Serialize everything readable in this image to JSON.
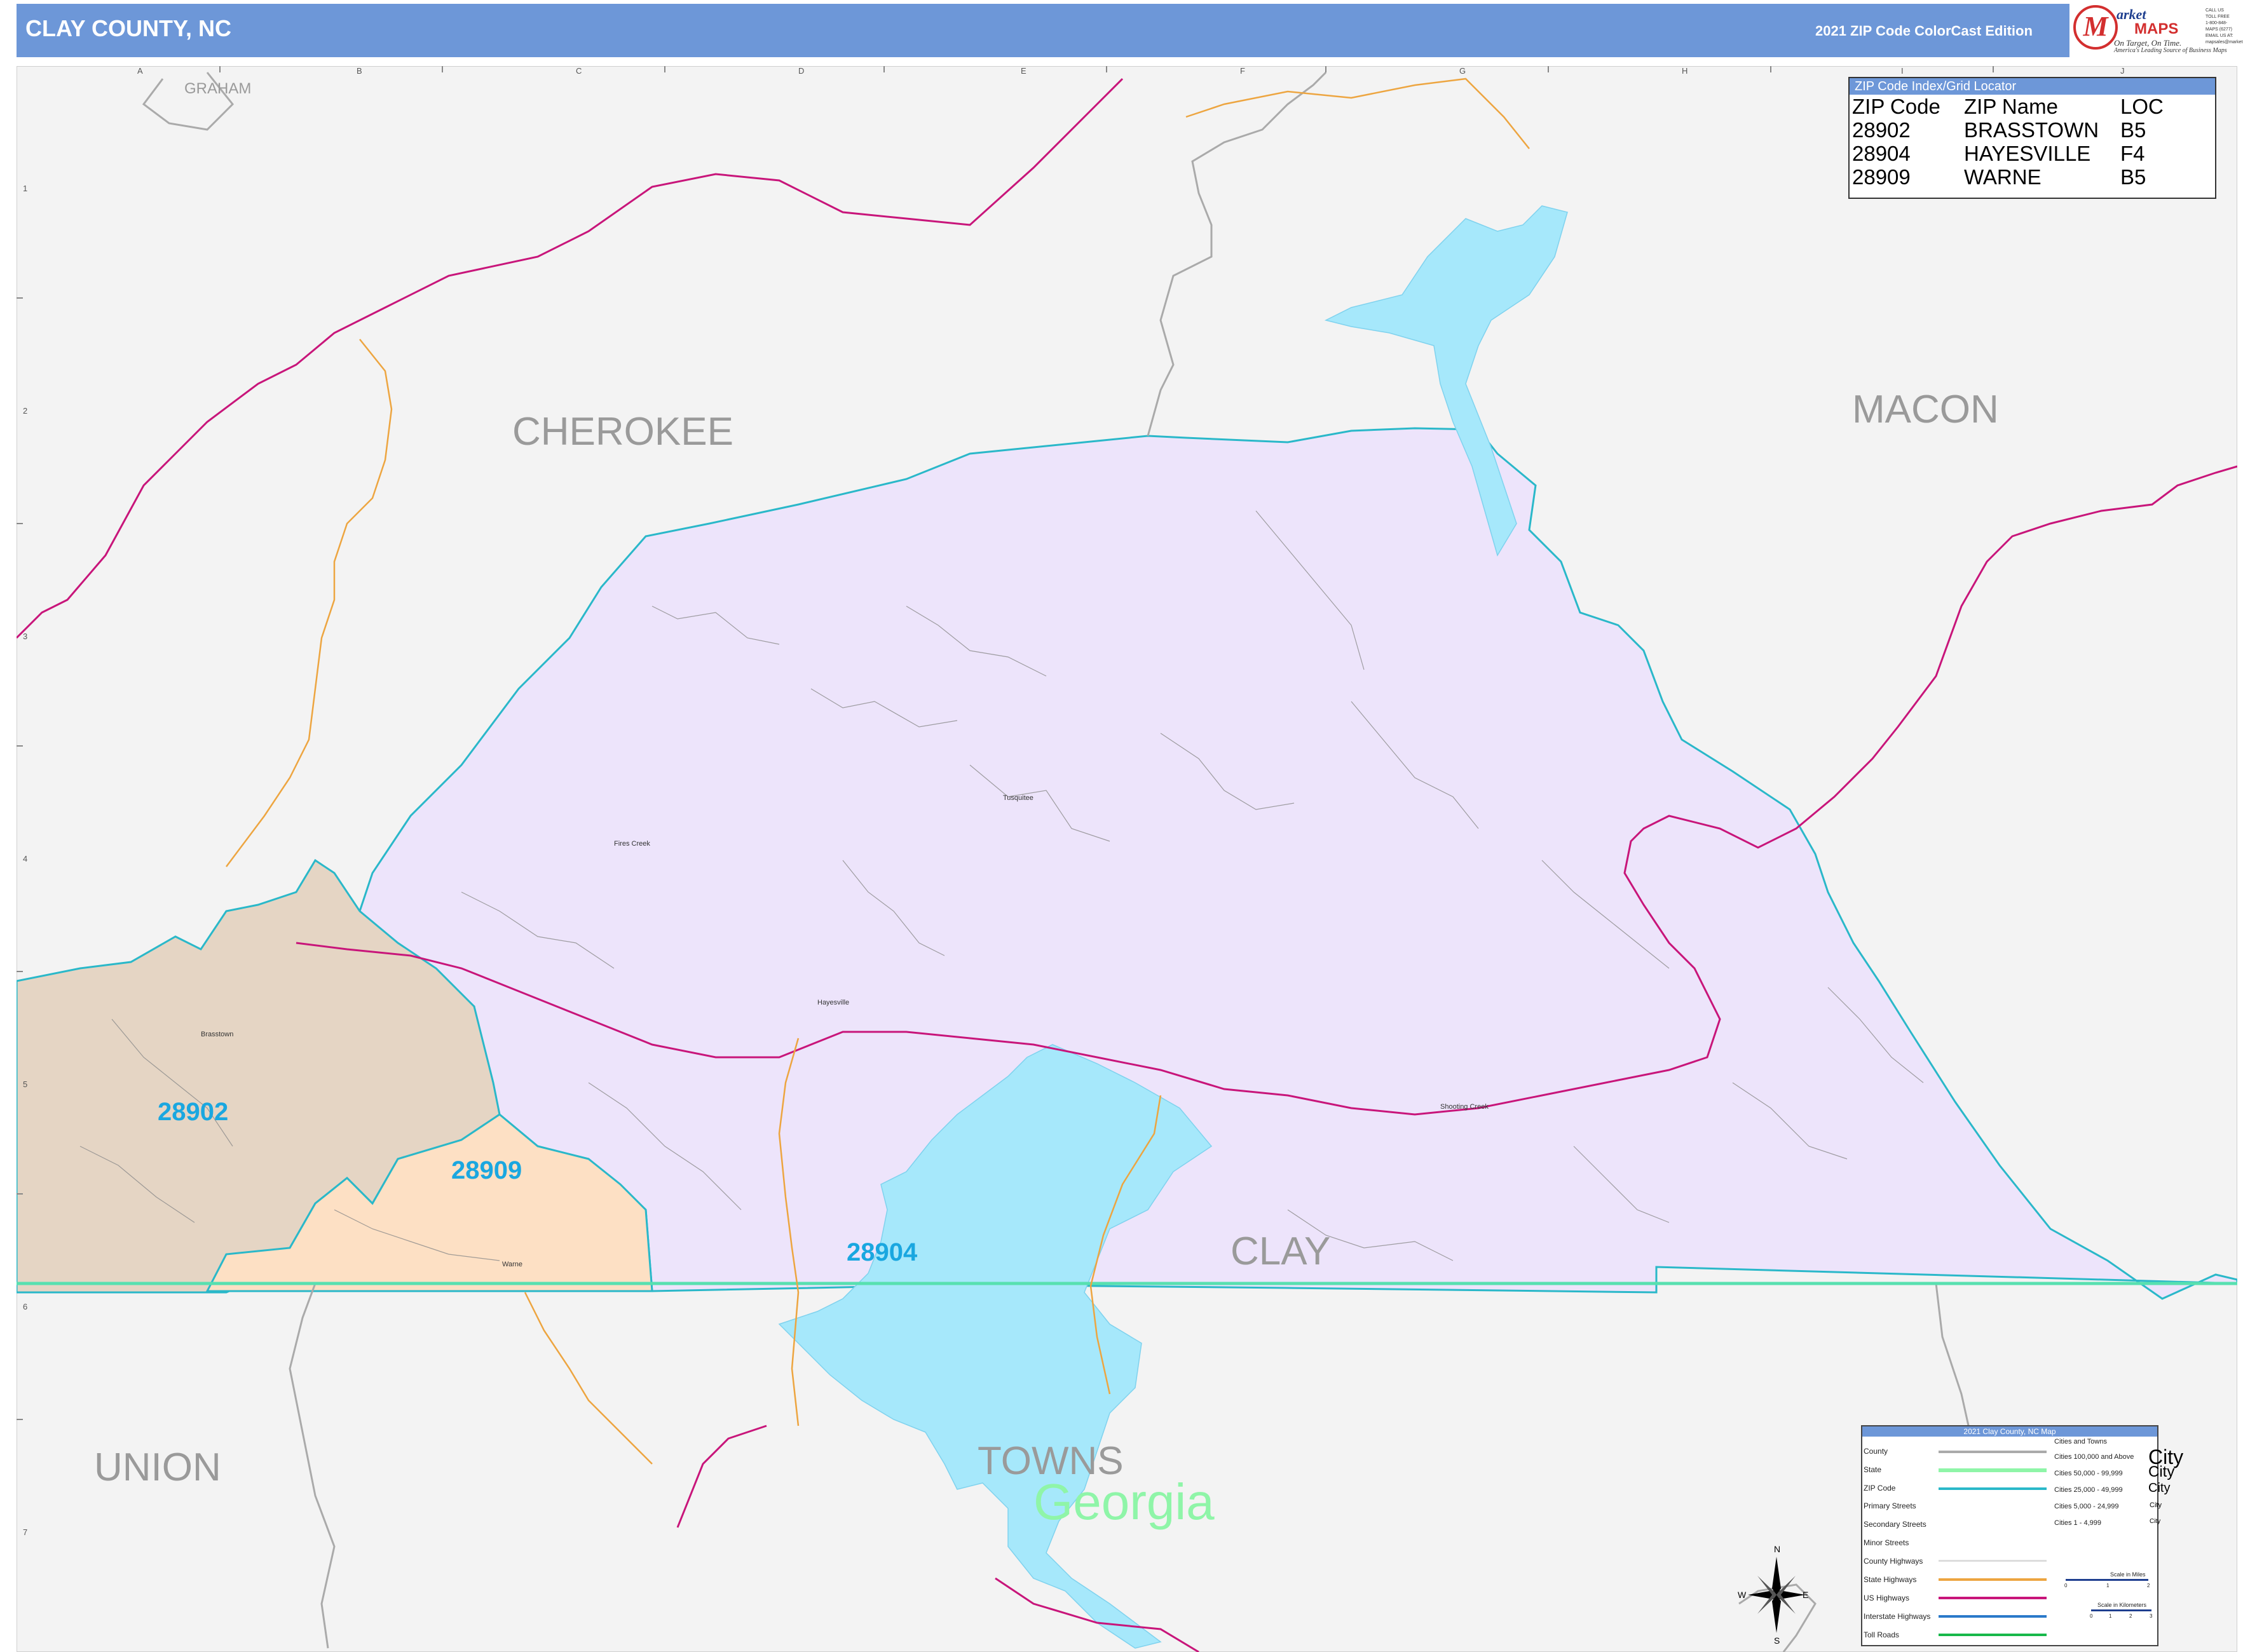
{
  "header": {
    "title": "CLAY COUNTY, NC",
    "edition": "2021 ZIP Code ColorCast Edition",
    "logo": {
      "letter": "M",
      "word1": "arket",
      "word2": "MAPS",
      "tagline": "On Target, On Time.",
      "tagline2": "America's Leading Source of Business Maps",
      "contact": [
        "CALL US TOLL FREE",
        "1-800-848-MAPS (6277)",
        "EMAIL US AT:",
        "mapsales@marketmaps.com"
      ]
    }
  },
  "grid": {
    "columns": [
      "A",
      "B",
      "C",
      "D",
      "E",
      "F",
      "G",
      "H",
      "I",
      "J"
    ],
    "rows": [
      "1",
      "2",
      "3",
      "4",
      "5",
      "6",
      "7"
    ]
  },
  "place_labels": {
    "graham": "GRAHAM",
    "cherokee": "CHEROKEE",
    "macon": "MACON",
    "clay": "CLAY",
    "union": "UNION",
    "towns": "TOWNS",
    "georgia": "Georgia"
  },
  "zip_labels": {
    "z28902": "28902",
    "z28909": "28909",
    "z28904": "28904"
  },
  "towns": {
    "brasstown": "Brasstown",
    "warne": "Warne",
    "hayesville": "Hayesville",
    "tusquitee": "Tusquitee",
    "fires_creek": "Fires Creek",
    "shooting_creek": "Shooting Creek"
  },
  "zip_index": {
    "title": "ZIP Code Index/Grid Locator",
    "headers": [
      "ZIP Code",
      "ZIP Name",
      "LOC"
    ],
    "rows": [
      [
        "28902",
        "BRASSTOWN",
        "B5"
      ],
      [
        "28904",
        "HAYESVILLE",
        "F4"
      ],
      [
        "28909",
        "WARNE",
        "B5"
      ]
    ]
  },
  "legend": {
    "title": "2021 Clay County, NC Map",
    "items": [
      "County",
      "State",
      "ZIP Code",
      "Primary Streets",
      "Secondary Streets",
      "Minor Streets",
      "County Highways",
      "State Highways",
      "US Highways",
      "Interstate Highways",
      "Toll Roads"
    ],
    "cities_title": "Cities and Towns",
    "cities": [
      {
        "label": "Cities 100,000 and Above",
        "sample": "City"
      },
      {
        "label": "Cities 50,000 - 99,999",
        "sample": "City"
      },
      {
        "label": "Cities 25,000 - 49,999",
        "sample": "City"
      },
      {
        "label": "Cities 5,000 - 24,999",
        "sample": "City"
      },
      {
        "label": "Cities 1 - 4,999",
        "sample": "City"
      }
    ],
    "scale_miles": "Scale in Miles",
    "scale_km": "Scale in Kilometers",
    "miles_ticks": [
      "0",
      "1",
      "2"
    ],
    "km_ticks": [
      "0",
      "1",
      "2",
      "3"
    ]
  },
  "compass": {
    "n": "N",
    "s": "S",
    "e": "E",
    "w": "W"
  },
  "colors": {
    "header": "#6d97d8",
    "zip_28904": "#ede4fb",
    "zip_28902": "#e5d5c4",
    "zip_28909": "#fde0c4",
    "water": "#a6e8fb",
    "zip_boundary": "#2ab8c9",
    "state_line": "#58e0b0",
    "us_highway": "#c8157a",
    "state_highway": "#eda540",
    "county_line": "#aaaaaa",
    "zip_label": "#1aa7e0",
    "background": "#f3f3f3"
  }
}
